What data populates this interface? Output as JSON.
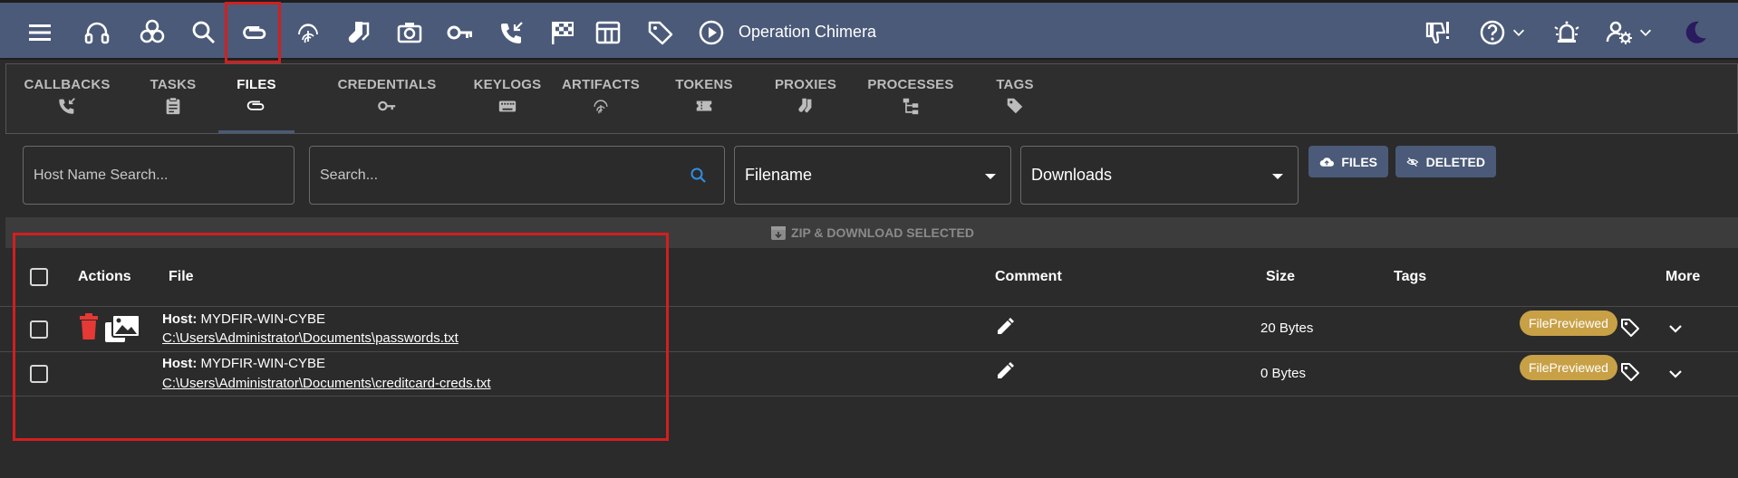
{
  "app": {
    "operation_name": "Operation Chimera"
  },
  "toolbar": {
    "left_icons": [
      "menu-icon",
      "headphones-icon",
      "biohazard-icon",
      "search-icon",
      "paperclip-icon",
      "fingerprint-icon",
      "socks-icon",
      "camera-icon",
      "key-icon",
      "phone-callback-icon",
      "checkered-flag-icon",
      "table-icon",
      "tag-icon",
      "play-circle-icon"
    ],
    "right_icons": [
      "thumbs-down-alert-icon",
      "help-icon",
      "alarm-bell-icon",
      "user-settings-icon",
      "moon-icon"
    ]
  },
  "tabs": [
    {
      "label": "CALLBACKS",
      "icon": "phone-callback-icon"
    },
    {
      "label": "TASKS",
      "icon": "clipboard-icon"
    },
    {
      "label": "FILES",
      "icon": "paperclip-icon",
      "active": true
    },
    {
      "label": "CREDENTIALS",
      "icon": "key-icon"
    },
    {
      "label": "KEYLOGS",
      "icon": "keyboard-icon"
    },
    {
      "label": "ARTIFACTS",
      "icon": "fingerprint-icon"
    },
    {
      "label": "TOKENS",
      "icon": "ticket-icon"
    },
    {
      "label": "PROXIES",
      "icon": "socks-icon"
    },
    {
      "label": "PROCESSES",
      "icon": "tree-icon"
    },
    {
      "label": "TAGS",
      "icon": "tag-icon"
    }
  ],
  "filters": {
    "host_placeholder": "Host Name Search...",
    "search_placeholder": "Search...",
    "field_select": "Filename",
    "type_select": "Downloads",
    "files_button": "FILES",
    "deleted_button": "DELETED"
  },
  "zip_label": "ZIP & DOWNLOAD SELECTED",
  "table": {
    "headers": {
      "actions": "Actions",
      "file": "File",
      "comment": "Comment",
      "size": "Size",
      "tags": "Tags",
      "more": "More"
    },
    "host_label": "Host:",
    "rows": [
      {
        "host": "MYDFIR-WIN-CYBE",
        "path": "C:\\Users\\Administrator\\Documents\\passwords.txt",
        "size": "20 Bytes",
        "tag": "FilePreviewed"
      },
      {
        "host": "MYDFIR-WIN-CYBE",
        "path": "C:\\Users\\Administrator\\Documents\\creditcard-creds.txt",
        "size": "0 Bytes",
        "tag": "FilePreviewed"
      }
    ]
  },
  "colors": {
    "accent": "#4b5a78",
    "badge": "#c8a046",
    "highlight": "#d21f1f",
    "delete": "#e53935"
  }
}
